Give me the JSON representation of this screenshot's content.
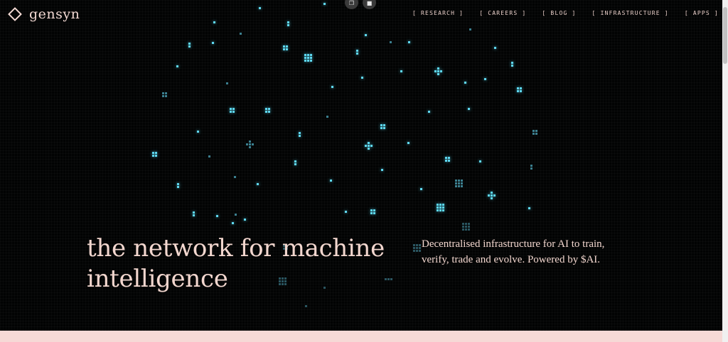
{
  "brand": {
    "name": "gensyn",
    "accent": "#f3d7cf",
    "pixel_color": "#5fd8f0"
  },
  "nav": {
    "items": [
      {
        "label": "[ RESEARCH ]"
      },
      {
        "label": "[ CAREERS ]"
      },
      {
        "label": "[ BLOG ]"
      },
      {
        "label": "[ INFRASTRUCTURE ]"
      },
      {
        "label": "[ APPS ]"
      }
    ]
  },
  "hero": {
    "headline_line1": "the network for machine",
    "headline_line2": "intelligence",
    "tagline_line1": "Decentralised infrastructure for AI to train,",
    "tagline_line2": "verify, trade and evolve. Powered by $AI."
  },
  "controls": {
    "icons": [
      "copy-icon",
      "video-icon"
    ]
  }
}
